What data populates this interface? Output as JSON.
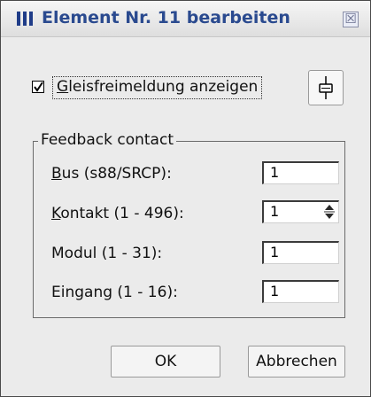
{
  "window": {
    "title": "Element Nr. 11 bearbeiten",
    "close_glyph": "☒"
  },
  "occupancy": {
    "checked": true,
    "label_first": "G",
    "label_rest": "leisfreimeldung anzeigen",
    "track_icon": "track-element-icon"
  },
  "feedback": {
    "group_title": "Feedback contact",
    "rows": [
      {
        "label_first": "B",
        "label_rest": "us (s88/SRCP):",
        "value": "1",
        "spinner": false
      },
      {
        "label_first": "K",
        "label_rest": "ontakt (1 - 496):",
        "value": "1",
        "spinner": true
      },
      {
        "label_first": "",
        "label_rest": "Modul (1 - 31):",
        "value": "1",
        "spinner": false
      },
      {
        "label_first": "",
        "label_rest": "Eingang (1 - 16):",
        "value": "1",
        "spinner": false
      }
    ]
  },
  "buttons": {
    "ok": "OK",
    "cancel": "Abbrechen"
  },
  "colors": {
    "title_text": "#2a4a8f",
    "app_icon": "#1f3c88",
    "dialog_bg": "#ebebeb"
  }
}
